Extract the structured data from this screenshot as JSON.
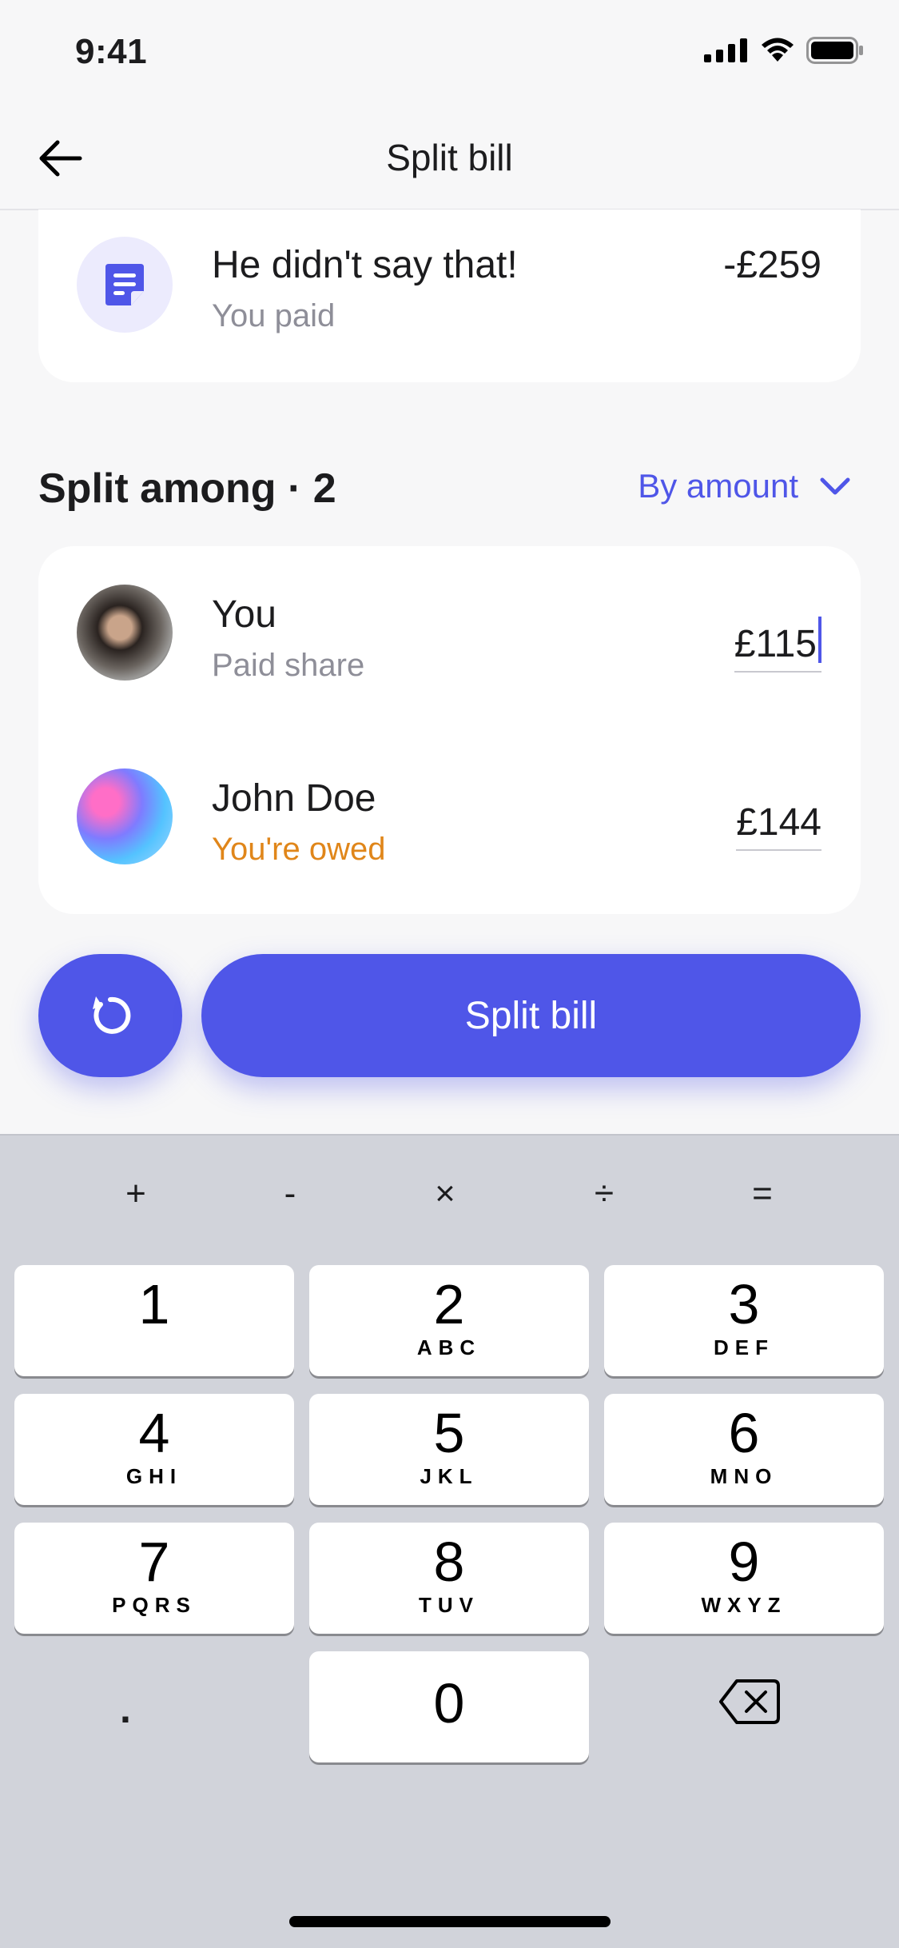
{
  "status_bar": {
    "time": "9:41"
  },
  "header": {
    "title": "Split bill"
  },
  "bill": {
    "title": "He didn't say that!",
    "subtitle": "You paid",
    "amount": "-£259"
  },
  "split": {
    "title": "Split among · 2",
    "mode": "By amount"
  },
  "people": [
    {
      "name": "You",
      "status": "Paid share",
      "amount": "£115",
      "status_color": "#8e8e98"
    },
    {
      "name": "John Doe",
      "status": "You're owed",
      "amount": "£144",
      "status_color": "#e0861a"
    }
  ],
  "actions": {
    "split_label": "Split bill"
  },
  "keyboard": {
    "operators": [
      "+",
      "-",
      "×",
      "÷",
      "="
    ],
    "keys": [
      {
        "num": "1",
        "letters": ""
      },
      {
        "num": "2",
        "letters": "ABC"
      },
      {
        "num": "3",
        "letters": "DEF"
      },
      {
        "num": "4",
        "letters": "GHI"
      },
      {
        "num": "5",
        "letters": "JKL"
      },
      {
        "num": "6",
        "letters": "MNO"
      },
      {
        "num": "7",
        "letters": "PQRS"
      },
      {
        "num": "8",
        "letters": "TUV"
      },
      {
        "num": "9",
        "letters": "WXYZ"
      },
      {
        "num": "0",
        "letters": ""
      }
    ],
    "dot": "."
  },
  "colors": {
    "accent": "#4f56e8",
    "owed": "#e0861a"
  }
}
